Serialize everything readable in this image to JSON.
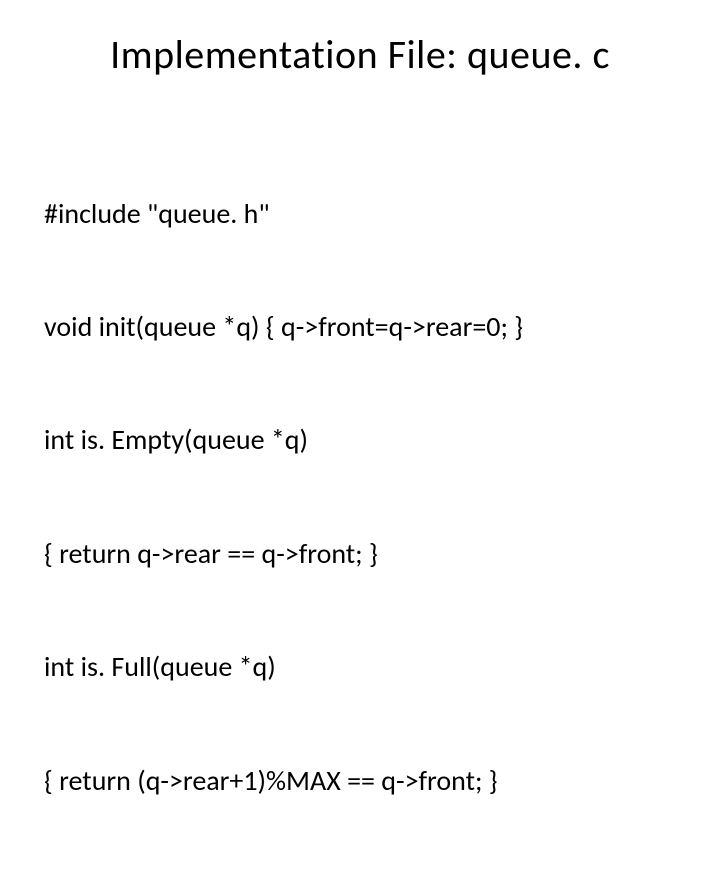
{
  "slide": {
    "title": "Implementation File: queue. c",
    "code_lines": [
      "#include \"queue. h\"",
      "void init(queue *q) { q->front=q->rear=0; }",
      "int is. Empty(queue *q)",
      "{ return q->rear == q->front; }",
      "int is. Full(queue *q)",
      "{ return (q->rear+1)%MAX == q->front; }"
    ]
  }
}
